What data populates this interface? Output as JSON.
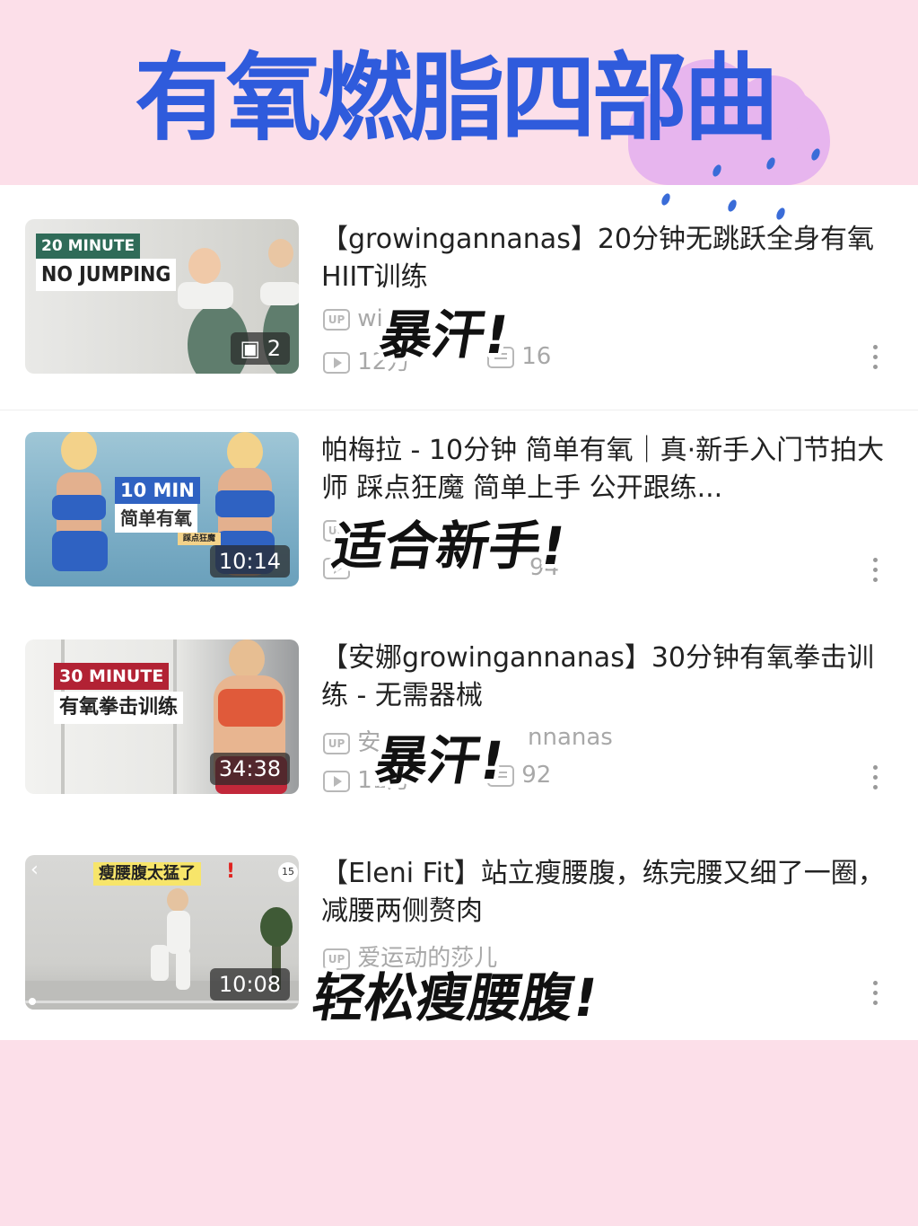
{
  "page_title": "有氧燃脂四部曲",
  "colors": {
    "background": "#fcdfe9",
    "title": "#2f5bdc",
    "cloud": "#e7b5ee"
  },
  "videos": [
    {
      "thumb": {
        "line1": "20 MINUTE",
        "line2": "NO JUMPING",
        "badge": "2"
      },
      "title": "【growingannanas】20分钟无跳跃全身有氧HIIT训练",
      "uploader": "wi",
      "views": "12万",
      "comments": "16",
      "overlay": "暴汗!"
    },
    {
      "thumb": {
        "line1": "10 MIN",
        "line2": "简单有氧",
        "line3": "踩点狂魔",
        "badge": "10:14"
      },
      "title": "帕梅拉 - 10分钟 简单有氧｜真·新手入门节拍大师 踩点狂魔 简单上手 公开跟练...",
      "uploader": "",
      "views": "",
      "comments": "94",
      "overlay": "适合新手!"
    },
    {
      "thumb": {
        "line1": "30 MINUTE",
        "line2": "有氧拳击训练",
        "badge": "34:38"
      },
      "title": "【安娜growingannanas】30分钟有氧拳击训练 - 无需器械",
      "uploader": "安",
      "uploader_tail": "nnanas",
      "views": "11万",
      "comments": "92",
      "overlay": "暴汗!"
    },
    {
      "thumb": {
        "line1": "瘦腰腹太猛了",
        "mark": "!",
        "corner": "15",
        "badge": "10:08"
      },
      "title": "【Eleni Fit】站立瘦腰腹，练完腰又细了一圈，减腰两侧赘肉",
      "uploader": "爱运动的莎儿",
      "overlay": "轻松瘦腰腹!"
    }
  ]
}
